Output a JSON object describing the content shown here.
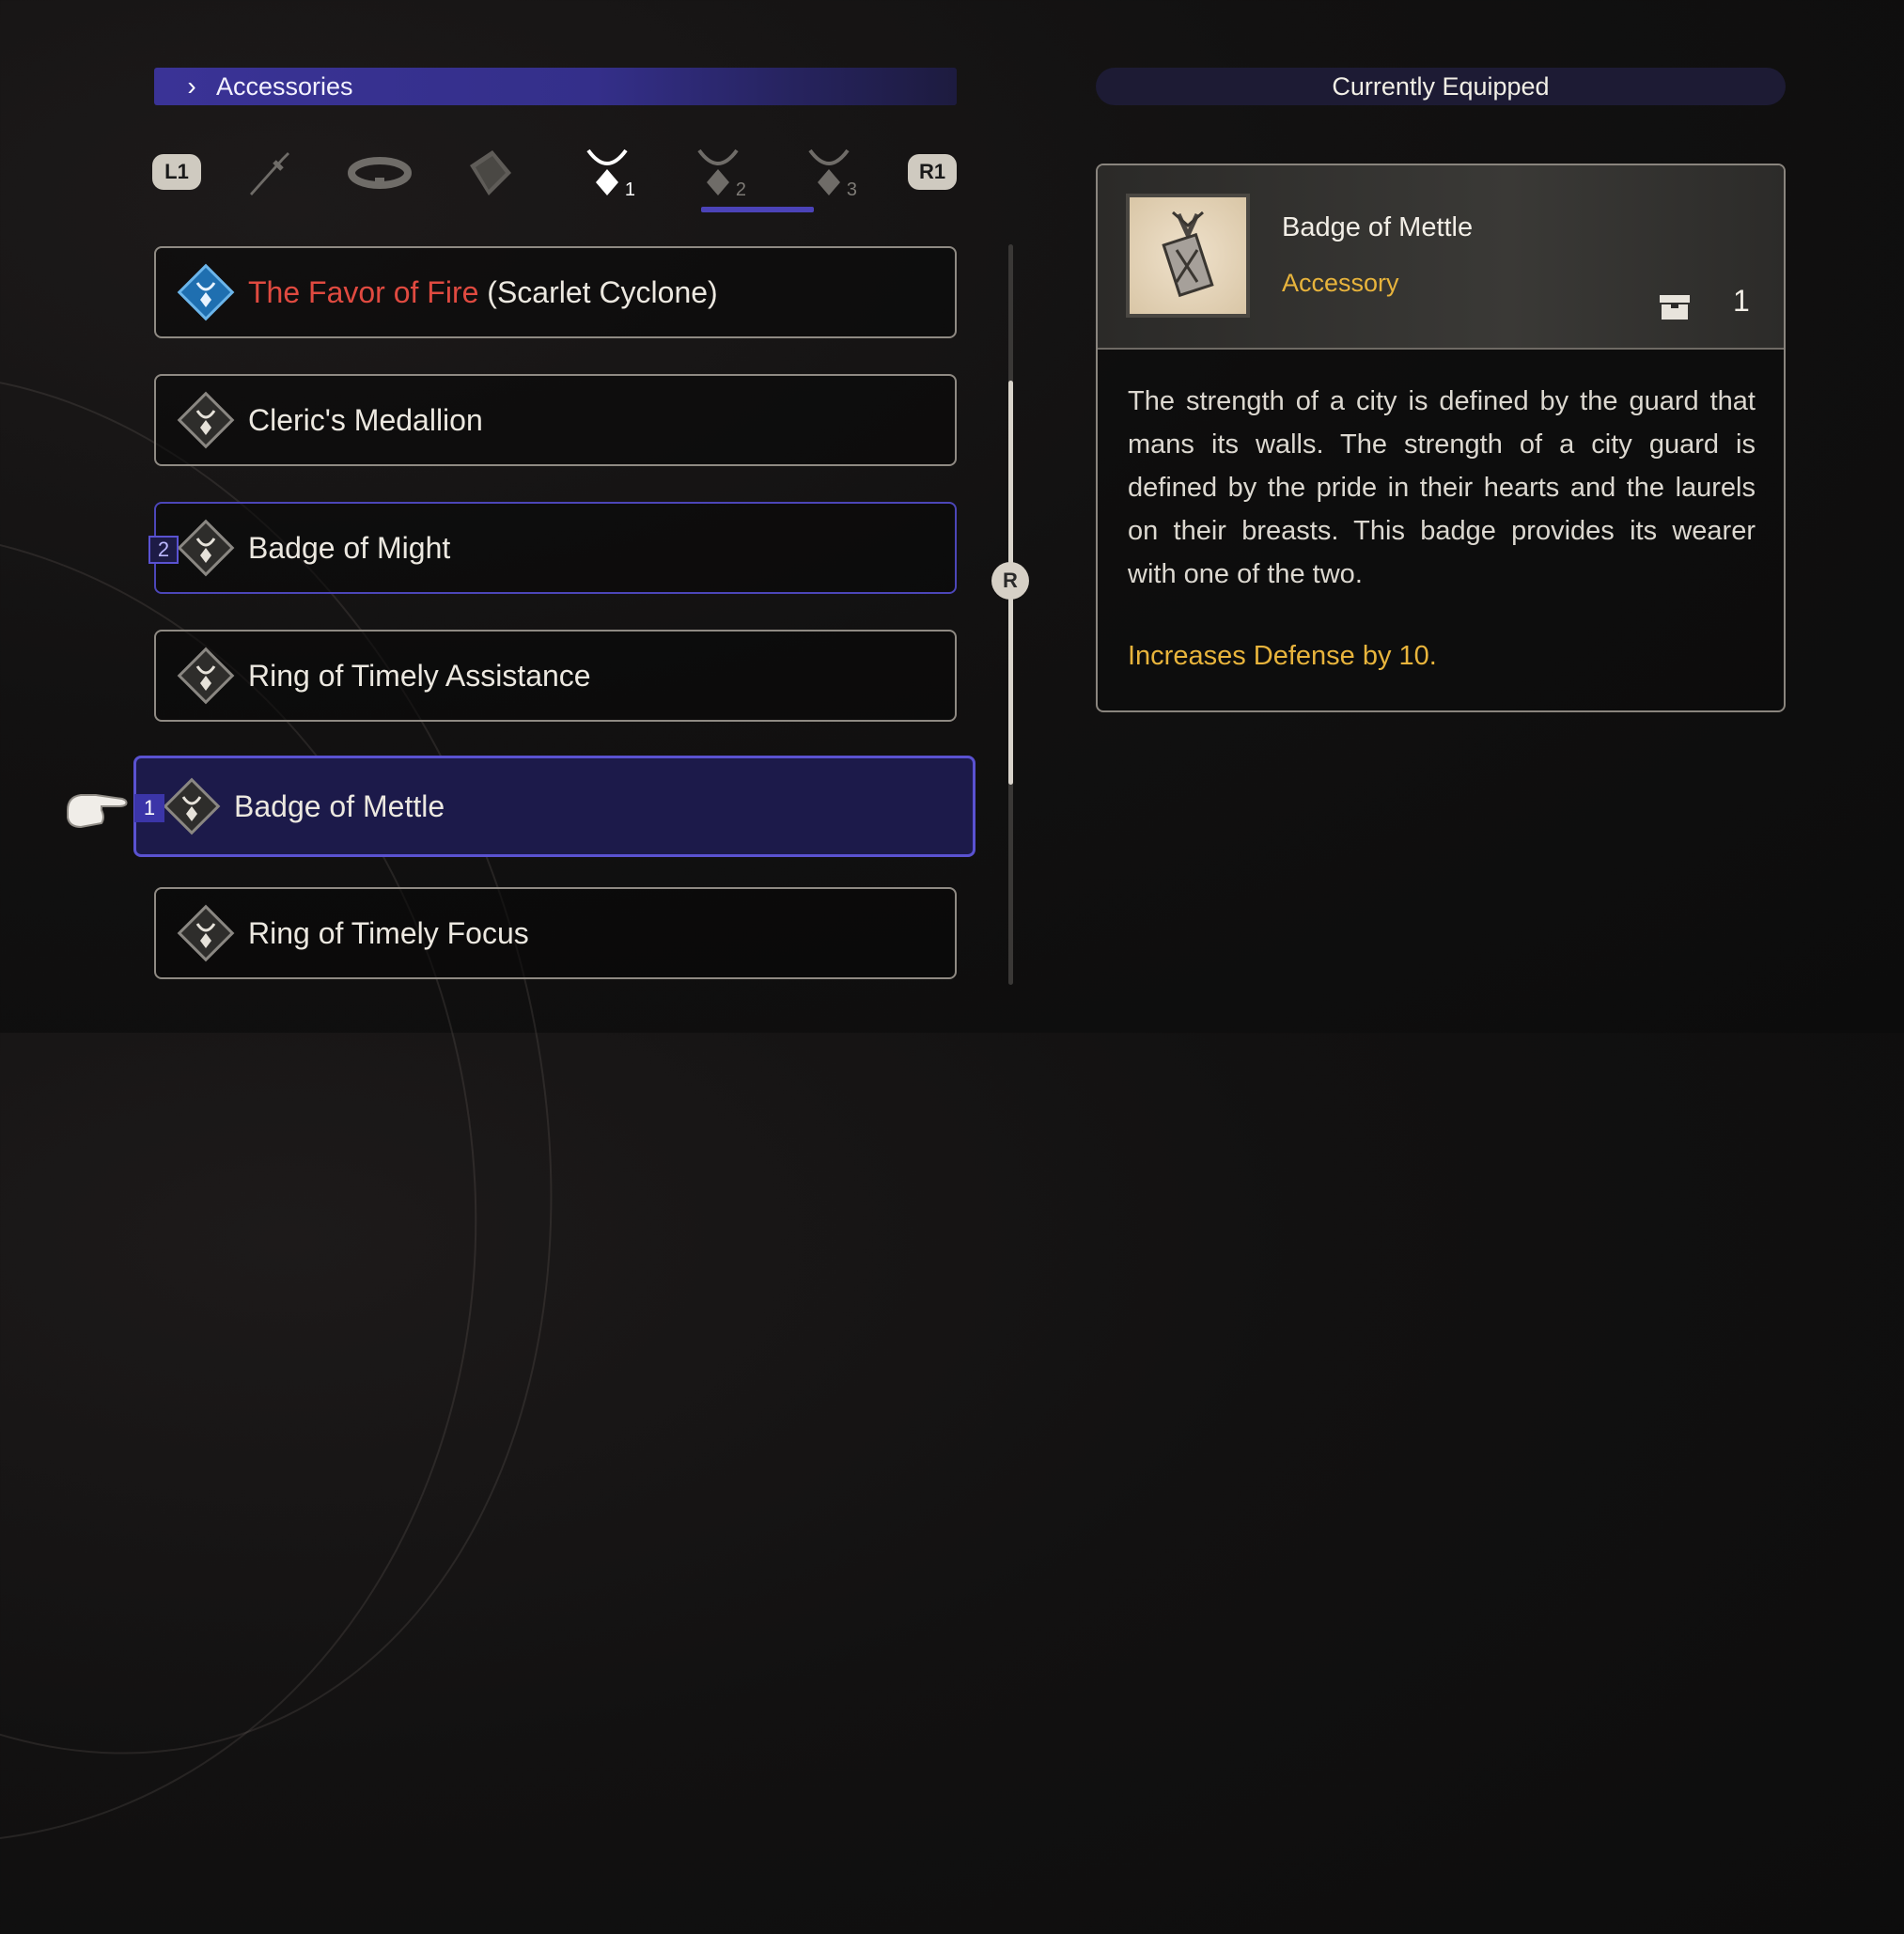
{
  "header": {
    "section_title": "Accessories",
    "equipped_title": "Currently Equipped"
  },
  "tabs": {
    "left_button": "L1",
    "right_button": "R1",
    "items": [
      {
        "icon": "sword-icon",
        "num": ""
      },
      {
        "icon": "bracer-icon",
        "num": ""
      },
      {
        "icon": "armor-icon",
        "num": ""
      },
      {
        "icon": "accessory-icon",
        "num": "1",
        "active": true
      },
      {
        "icon": "accessory-icon",
        "num": "2"
      },
      {
        "icon": "accessory-icon",
        "num": "3"
      }
    ]
  },
  "list": {
    "items": [
      {
        "name_red": "The Favor of Fire",
        "name": " (Scarlet Cyclone)",
        "slot": ""
      },
      {
        "name": "Cleric's Medallion",
        "slot": ""
      },
      {
        "name": "Badge of Might",
        "slot": "2"
      },
      {
        "name": "Ring of Timely Assistance",
        "slot": ""
      },
      {
        "name": "Badge of Mettle",
        "slot": "1",
        "selected": true
      },
      {
        "name": "Ring of Timely Focus",
        "slot": ""
      }
    ],
    "scroll_button": "R"
  },
  "detail": {
    "name": "Badge of Mettle",
    "type": "Accessory",
    "count": "1",
    "description": "The strength of a city is defined by the guard that mans its walls. The strength of a city guard is defined by the pride in their hearts and the laurels on their breasts. This badge provides its wearer with one of the two.",
    "effect": "Increases Defense by 10."
  },
  "colors": {
    "accent": "#4b43b8",
    "highlight_text": "#e8b43c",
    "alert_text": "#e04a40"
  }
}
